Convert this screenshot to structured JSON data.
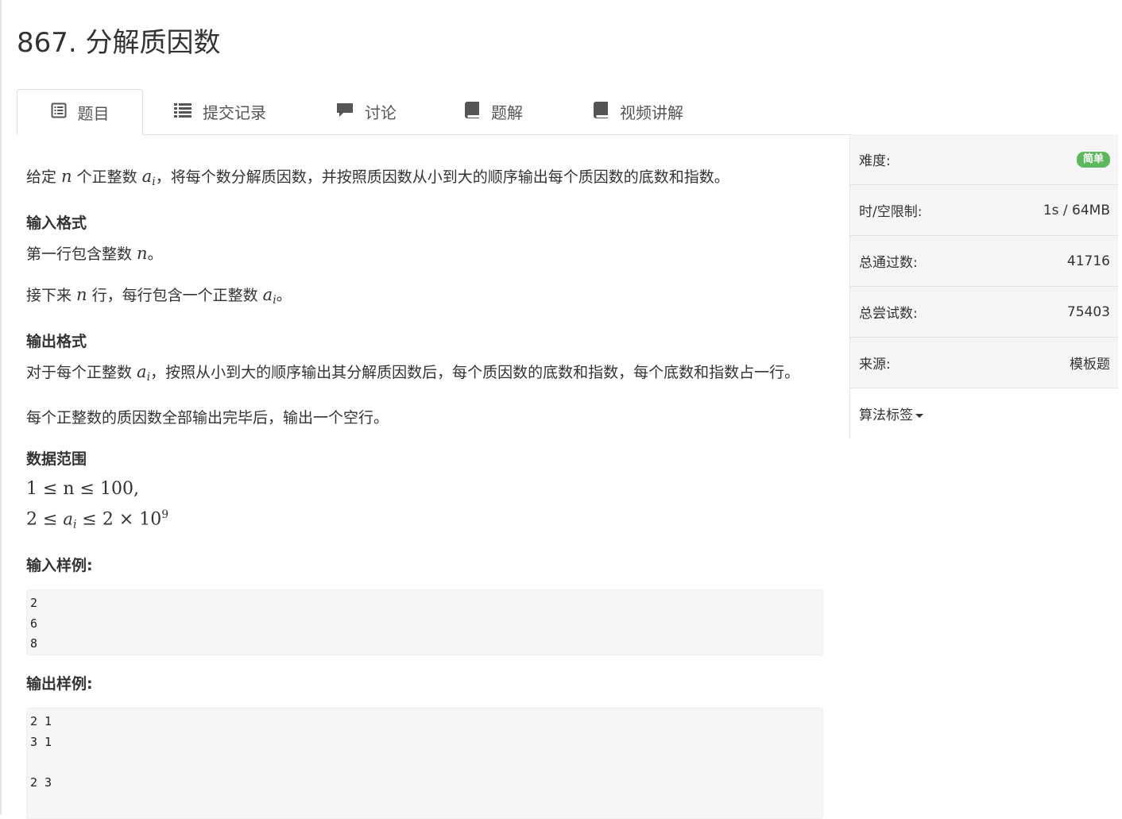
{
  "page": {
    "title": "867. 分解质因数"
  },
  "tabs": [
    {
      "label": "题目",
      "icon": "list-alt-icon",
      "active": true
    },
    {
      "label": "提交记录",
      "icon": "list-icon",
      "active": false
    },
    {
      "label": "讨论",
      "icon": "comment-icon",
      "active": false
    },
    {
      "label": "题解",
      "icon": "book-icon",
      "active": false
    },
    {
      "label": "视频讲解",
      "icon": "book-icon",
      "active": false
    }
  ],
  "problem": {
    "desc_pre": "给定 ",
    "desc_n": "n",
    "desc_mid": " 个正整数 ",
    "desc_a": "a",
    "desc_i": "i",
    "desc_post": "，将每个数分解质因数，并按照质因数从小到大的顺序输出每个质因数的底数和指数。",
    "input_heading": "输入格式",
    "input_line1_pre": "第一行包含整数 ",
    "input_line1_var": "n",
    "input_line1_post": "。",
    "input_line2_pre": "接下来 ",
    "input_line2_var": "n",
    "input_line2_mid": " 行，每行包含一个正整数 ",
    "input_line2_a": "a",
    "input_line2_i": "i",
    "input_line2_post": "。",
    "output_heading": "输出格式",
    "output_line1_pre": "对于每个正整数 ",
    "output_line1_a": "a",
    "output_line1_i": "i",
    "output_line1_post": "，按照从小到大的顺序输出其分解质因数后，每个质因数的底数和指数，每个底数和指数占一行。",
    "output_line2": "每个正整数的质因数全部输出完毕后，输出一个空行。",
    "range_heading": "数据范围",
    "range_line1": "1 ≤ n ≤ 100,",
    "range_line2_pre": "2 ≤ ",
    "range_line2_a": "a",
    "range_line2_i": "i",
    "range_line2_post": " ≤ 2 × 10",
    "range_line2_exp": "9",
    "sample_input_heading": "输入样例:",
    "sample_input": "2\n6\n8",
    "sample_output_heading": "输出样例:",
    "sample_output": "2 1\n3 1\n\n2 3"
  },
  "sidebar": {
    "difficulty_label": "难度:",
    "difficulty_value": "简单",
    "difficulty_color": "#5cb85c",
    "limit_label": "时/空限制:",
    "limit_value": "1s / 64MB",
    "accepted_label": "总通过数:",
    "accepted_value": "41716",
    "attempts_label": "总尝试数:",
    "attempts_value": "75403",
    "source_label": "来源:",
    "source_value": "模板题",
    "tags_label": "算法标签"
  }
}
